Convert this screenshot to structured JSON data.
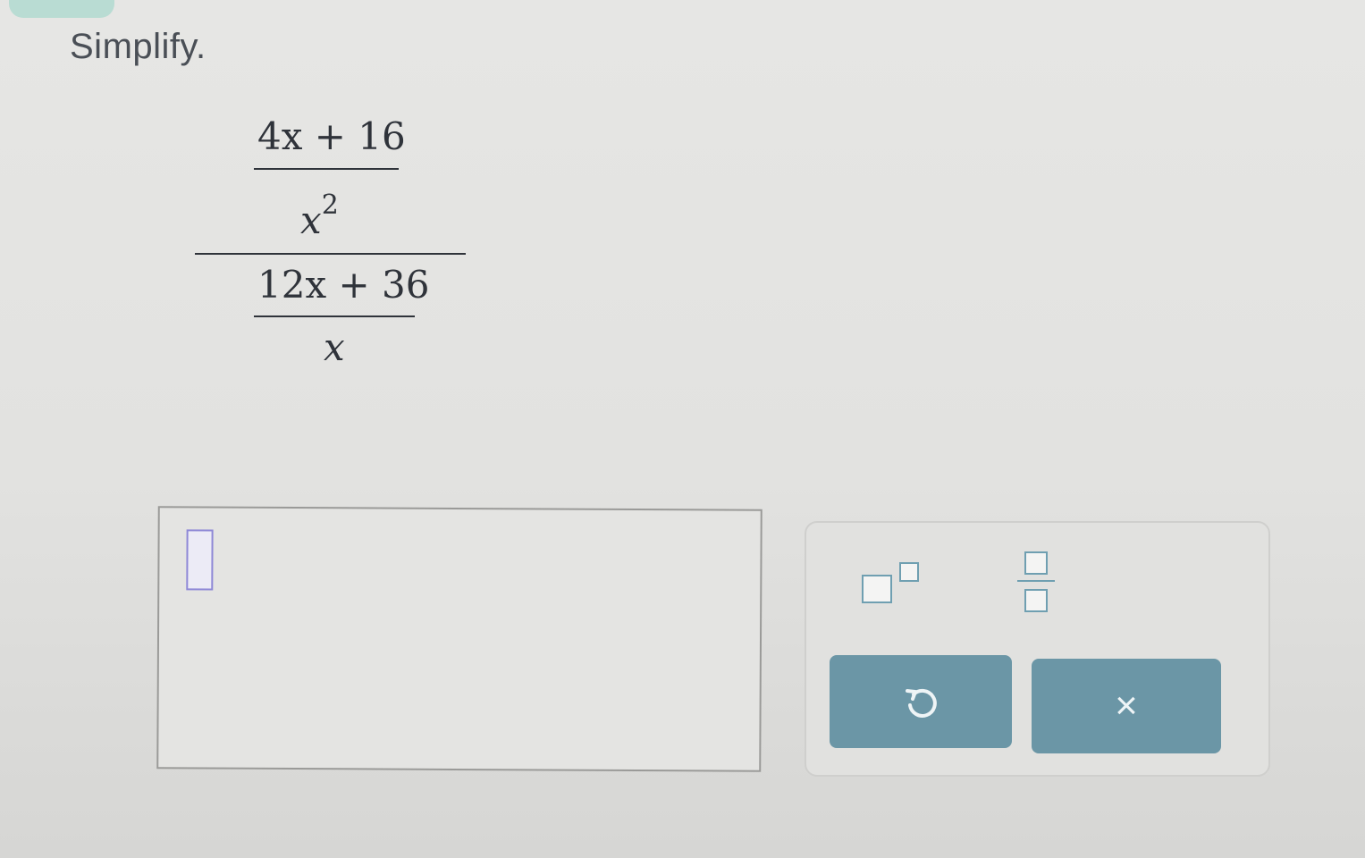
{
  "prompt": "Simplify.",
  "expression": {
    "top_numerator": "4x + 16",
    "top_denominator_base": "x",
    "top_denominator_exp": "2",
    "bottom_numerator": "12x + 36",
    "bottom_denominator": "x"
  },
  "answer": {
    "value": ""
  },
  "keypad": {
    "buttons": [
      {
        "name": "exponent",
        "icon": "superscript-template-icon"
      },
      {
        "name": "fraction",
        "icon": "fraction-template-icon"
      },
      {
        "name": "undo",
        "icon": "undo-icon"
      },
      {
        "name": "clear",
        "label": "×",
        "icon": "close-icon"
      }
    ]
  },
  "colors": {
    "accent": "#6b96a6",
    "cursor_border": "#8e88d6",
    "template_square": "#6f9fb1"
  }
}
